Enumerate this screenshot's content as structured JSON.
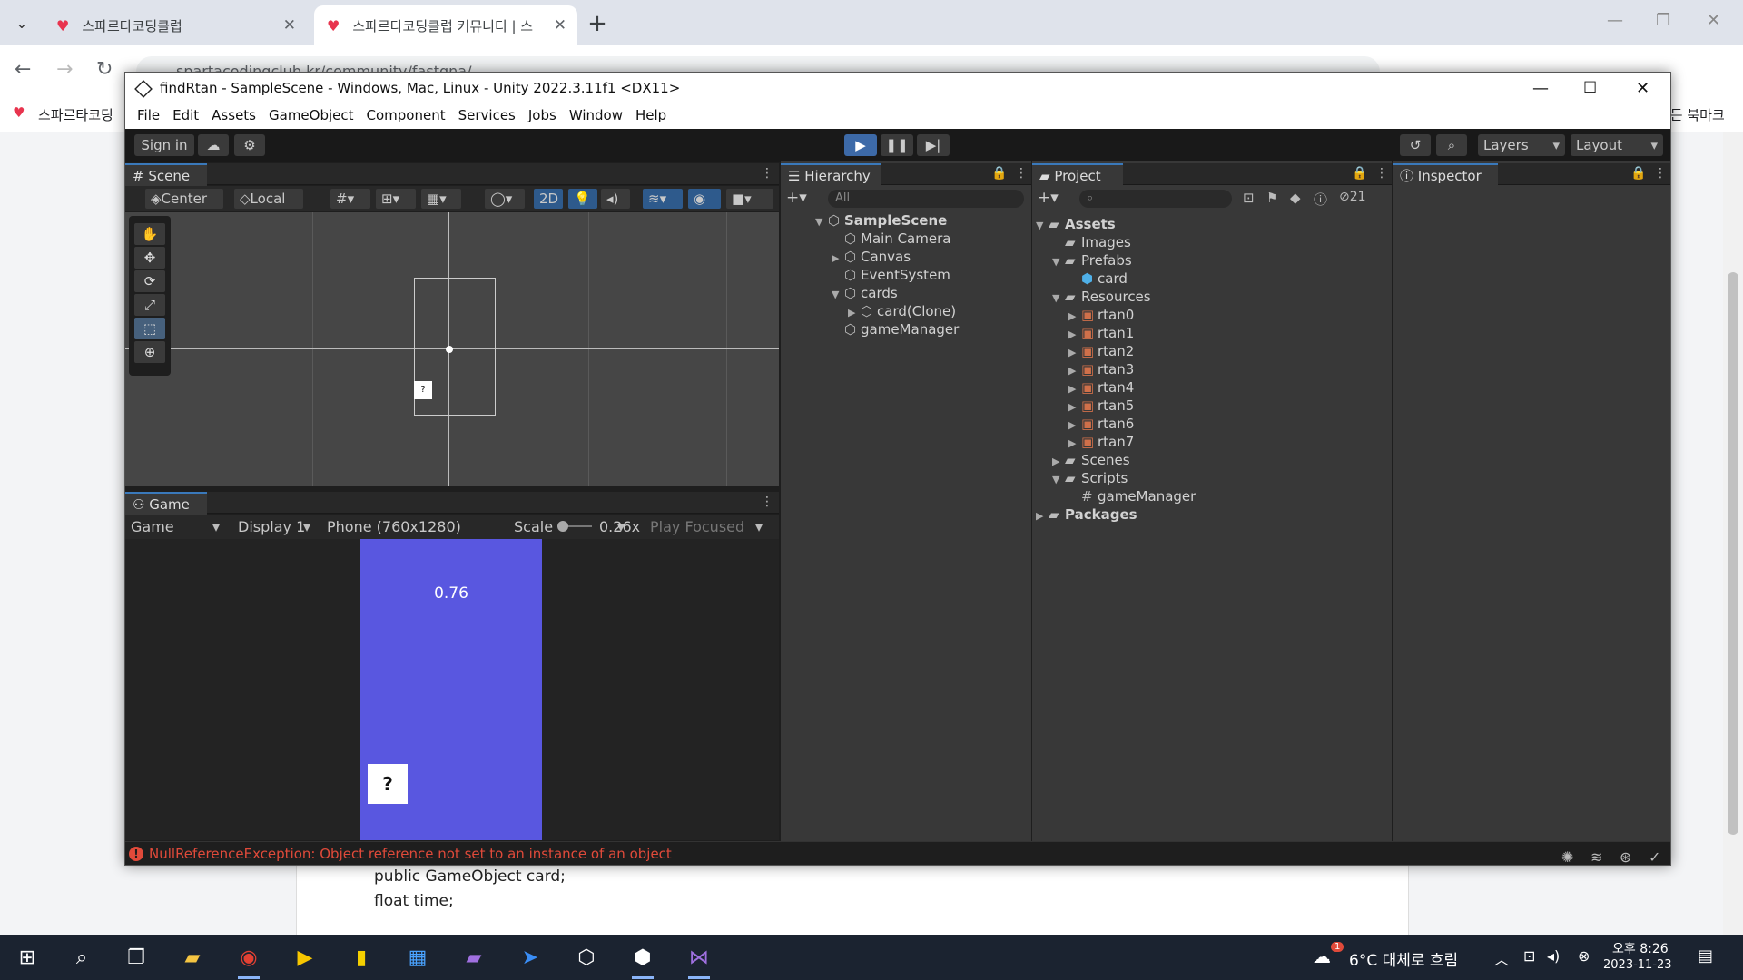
{
  "browser": {
    "tabs": [
      {
        "title": "스파르타코딩클럽",
        "active": false
      },
      {
        "title": "스파르타코딩클럽 커뮤니티 | 스",
        "active": true
      }
    ],
    "url": "spartacodingclub.kr/community/fastqna/...",
    "bookmark_left": "스파르타코딩",
    "bookmark_right": "모든 북마크",
    "close_glyph": "✕"
  },
  "page": {
    "code_lines": [
      "public GameObject card;",
      "float time;"
    ]
  },
  "unity": {
    "title": "findRtan - SampleScene - Windows, Mac, Linux - Unity 2022.3.11f1 <DX11>",
    "menu": [
      "File",
      "Edit",
      "Assets",
      "GameObject",
      "Component",
      "Services",
      "Jobs",
      "Window",
      "Help"
    ],
    "toolbar": {
      "sign_in": "Sign in",
      "layers": "Layers",
      "layout": "Layout"
    },
    "scene": {
      "tab": "Scene",
      "pivot": "Center",
      "space": "Local",
      "mode_2d": "2D",
      "card_label": "?"
    },
    "game": {
      "tab": "Game",
      "view": "Game",
      "display": "Display 1",
      "resolution": "Phone (760x1280)",
      "scale_label": "Scale",
      "scale_value": "0.26x",
      "play_mode": "Play Focused",
      "score": "0.76",
      "card_label": "?"
    },
    "hierarchy": {
      "tab": "Hierarchy",
      "search_placeholder": "All",
      "items": [
        {
          "label": "SampleScene",
          "depth": 0,
          "arrow": "▼",
          "bold": true
        },
        {
          "label": "Main Camera",
          "depth": 1,
          "arrow": ""
        },
        {
          "label": "Canvas",
          "depth": 1,
          "arrow": "▶"
        },
        {
          "label": "EventSystem",
          "depth": 1,
          "arrow": ""
        },
        {
          "label": "cards",
          "depth": 1,
          "arrow": "▼"
        },
        {
          "label": "card(Clone)",
          "depth": 2,
          "arrow": "▶"
        },
        {
          "label": "gameManager",
          "depth": 1,
          "arrow": ""
        }
      ]
    },
    "project": {
      "tab": "Project",
      "hidden_count": "21",
      "items": [
        {
          "label": "Assets",
          "depth": 0,
          "arrow": "▼",
          "bold": true,
          "icon": "folder"
        },
        {
          "label": "Images",
          "depth": 1,
          "arrow": "",
          "icon": "folder"
        },
        {
          "label": "Prefabs",
          "depth": 1,
          "arrow": "▼",
          "icon": "folder"
        },
        {
          "label": "card",
          "depth": 2,
          "arrow": "",
          "icon": "prefab"
        },
        {
          "label": "Resources",
          "depth": 1,
          "arrow": "▼",
          "icon": "folder"
        },
        {
          "label": "rtan0",
          "depth": 2,
          "arrow": "▶",
          "icon": "sprite"
        },
        {
          "label": "rtan1",
          "depth": 2,
          "arrow": "▶",
          "icon": "sprite"
        },
        {
          "label": "rtan2",
          "depth": 2,
          "arrow": "▶",
          "icon": "sprite"
        },
        {
          "label": "rtan3",
          "depth": 2,
          "arrow": "▶",
          "icon": "sprite"
        },
        {
          "label": "rtan4",
          "depth": 2,
          "arrow": "▶",
          "icon": "sprite"
        },
        {
          "label": "rtan5",
          "depth": 2,
          "arrow": "▶",
          "icon": "sprite"
        },
        {
          "label": "rtan6",
          "depth": 2,
          "arrow": "▶",
          "icon": "sprite"
        },
        {
          "label": "rtan7",
          "depth": 2,
          "arrow": "▶",
          "icon": "sprite"
        },
        {
          "label": "Scenes",
          "depth": 1,
          "arrow": "▶",
          "icon": "folder"
        },
        {
          "label": "Scripts",
          "depth": 1,
          "arrow": "▼",
          "icon": "folder"
        },
        {
          "label": "gameManager",
          "depth": 2,
          "arrow": "",
          "icon": "script"
        },
        {
          "label": "Packages",
          "depth": 0,
          "arrow": "▶",
          "bold": true,
          "icon": "folder"
        }
      ]
    },
    "inspector": {
      "tab": "Inspector"
    },
    "status": {
      "error": "NullReferenceException: Object reference not set to an instance of an object"
    },
    "colors": {
      "game_bg": "#5957e0",
      "error": "#e04a3a",
      "accent": "#3a79bb"
    }
  },
  "taskbar": {
    "weather": "6°C  대체로 흐림",
    "time_ampm": "오후 8:26",
    "date": "2023-11-23",
    "badge": "1"
  }
}
